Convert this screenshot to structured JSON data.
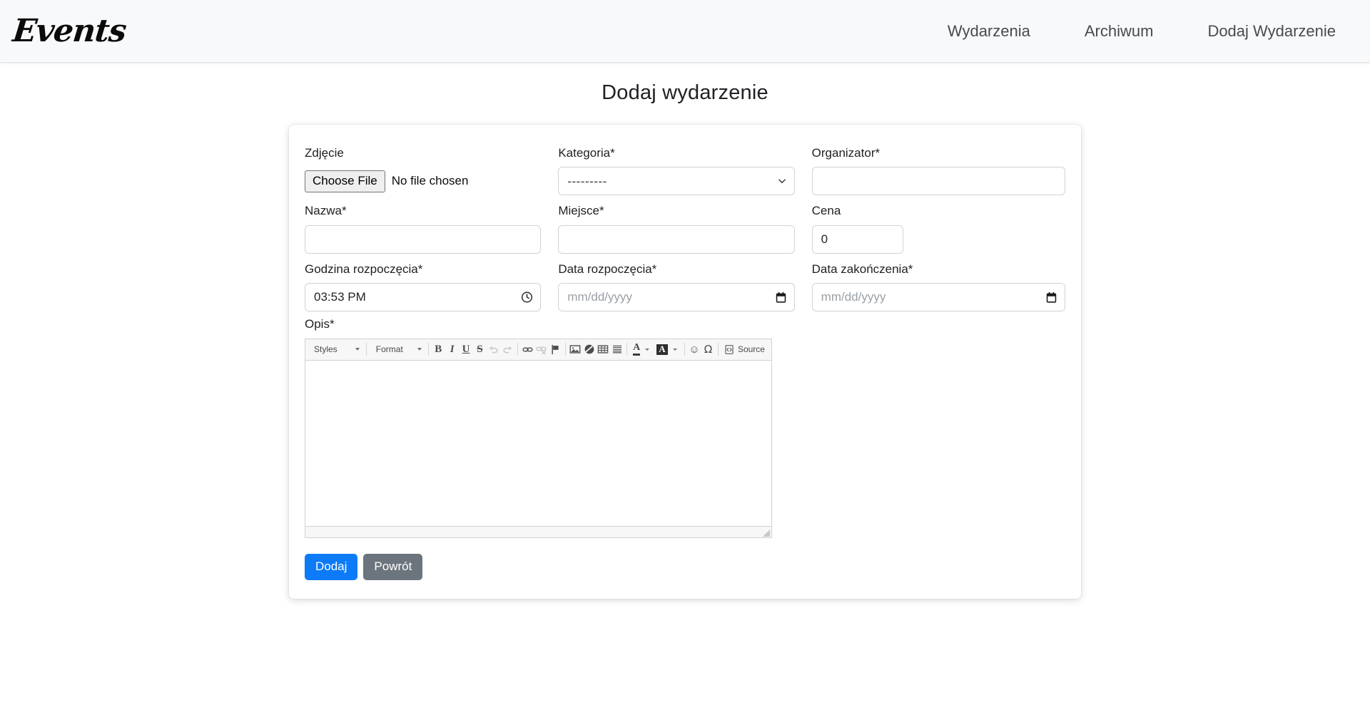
{
  "navbar": {
    "brand": "Events",
    "links": [
      {
        "label": "Wydarzenia",
        "name": "nav-link-wydarzenia"
      },
      {
        "label": "Archiwum",
        "name": "nav-link-archiwum"
      },
      {
        "label": "Dodaj Wydarzenie",
        "name": "nav-link-dodaj-wydarzenie"
      }
    ]
  },
  "page": {
    "title": "Dodaj wydarzenie"
  },
  "form": {
    "photo": {
      "label": "Zdjęcie",
      "button_label": "Choose File",
      "file_status": "No file chosen"
    },
    "category": {
      "label": "Kategoria*",
      "selected": "---------",
      "options": [
        "---------"
      ]
    },
    "organizer": {
      "label": "Organizator*",
      "value": "",
      "placeholder": ""
    },
    "name": {
      "label": "Nazwa*",
      "value": "",
      "placeholder": ""
    },
    "place": {
      "label": "Miejsce*",
      "value": "",
      "placeholder": ""
    },
    "price": {
      "label": "Cena",
      "value": "0",
      "placeholder": "0"
    },
    "start_time": {
      "label": "Godzina rozpoczęcia*",
      "value": "03:53 PM",
      "icon": "clock-icon"
    },
    "start_date": {
      "label": "Data rozpoczęcia*",
      "value": "",
      "placeholder": "mm/dd/yyyy",
      "icon": "calendar-icon"
    },
    "end_date": {
      "label": "Data zakończenia*",
      "value": "",
      "placeholder": "mm/dd/yyyy",
      "icon": "calendar-icon"
    },
    "description": {
      "label": "Opis*",
      "content": ""
    }
  },
  "editor": {
    "styles_label": "Styles",
    "format_label": "Format",
    "source_label": "Source",
    "buttons": [
      {
        "name": "bold-icon",
        "glyph": "B"
      },
      {
        "name": "italic-icon",
        "glyph": "I"
      },
      {
        "name": "underline-icon",
        "glyph": "U"
      },
      {
        "name": "strikethrough-icon",
        "glyph": "S"
      },
      {
        "name": "undo-icon",
        "glyph": "↰"
      },
      {
        "name": "redo-icon",
        "glyph": "↱"
      },
      {
        "name": "link-icon",
        "glyph": "🔗"
      },
      {
        "name": "unlink-icon",
        "glyph": "⛓"
      },
      {
        "name": "anchor-flag-icon",
        "glyph": "⚑"
      },
      {
        "name": "image-icon",
        "glyph": "🖼"
      },
      {
        "name": "flash-icon",
        "glyph": "◑"
      },
      {
        "name": "table-icon",
        "glyph": "▦"
      },
      {
        "name": "horizontal-rule-icon",
        "glyph": "≡"
      },
      {
        "name": "text-color-icon",
        "glyph": "A"
      },
      {
        "name": "background-color-icon",
        "glyph": "A"
      },
      {
        "name": "smiley-icon",
        "glyph": "☺"
      },
      {
        "name": "special-char-icon",
        "glyph": "Ω"
      },
      {
        "name": "source-icon",
        "glyph": "◁▷"
      }
    ]
  },
  "actions": {
    "submit_label": "Dodaj",
    "back_label": "Powrót"
  },
  "colors": {
    "primary": "#0d7bf7",
    "secondary": "#6c757d",
    "navbar_bg": "#f8f9fa",
    "text": "#202124"
  }
}
